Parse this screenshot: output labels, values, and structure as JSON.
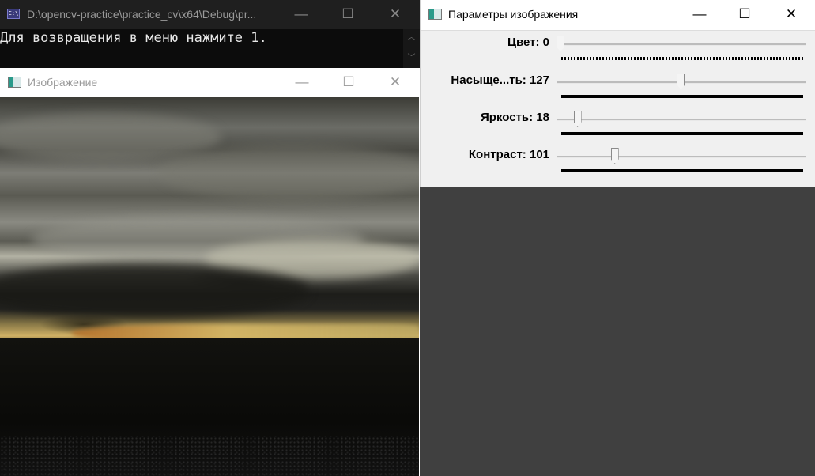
{
  "console": {
    "title": "D:\\opencv-practice\\practice_cv\\x64\\Debug\\pr...",
    "icon": "console-icon",
    "icon_text": "C:\\",
    "output_line": "Для возвращения в меню нажмите 1.",
    "controls": {
      "minimize": "—",
      "maximize": "☐",
      "close": "✕"
    },
    "scroll": {
      "up": "︿",
      "down": "﹀"
    }
  },
  "image_window": {
    "title": "Изображение",
    "icon": "opencv-window-icon",
    "controls": {
      "minimize": "—",
      "maximize": "☐",
      "close": "✕"
    }
  },
  "params_window": {
    "title": "Параметры изображения",
    "icon": "opencv-window-icon",
    "controls": {
      "minimize": "—",
      "maximize": "☐",
      "close": "✕"
    },
    "trackbars": [
      {
        "label": "Цвет: 0",
        "value": 0,
        "max": 179
      },
      {
        "label": "Насыще...ть: 127",
        "value": 127,
        "max": 255
      },
      {
        "label": "Яркость: 18",
        "value": 18,
        "max": 255
      },
      {
        "label": "Контраст: 101",
        "value": 101,
        "max": 450
      }
    ]
  },
  "colors": {
    "desktop": "#404040",
    "console_bg": "#0c0c0c",
    "dialog_bg": "#f0f0f0"
  }
}
